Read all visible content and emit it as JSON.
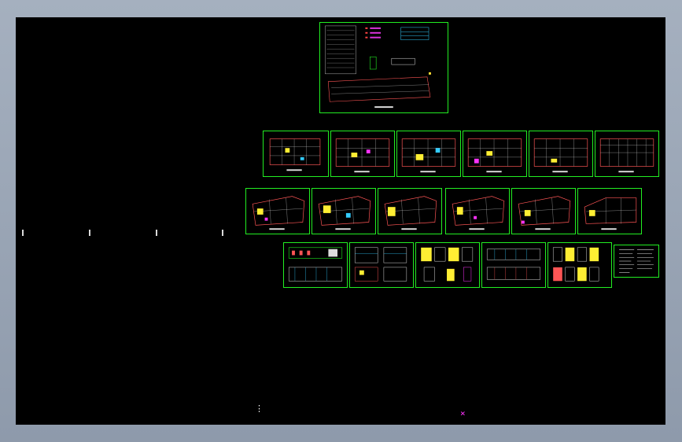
{
  "app": {
    "title": "",
    "accent_color": "#22ee22",
    "background_color": "#000000"
  },
  "canvas": {
    "origin_marker": "⋮",
    "magenta_marker": "×"
  }
}
